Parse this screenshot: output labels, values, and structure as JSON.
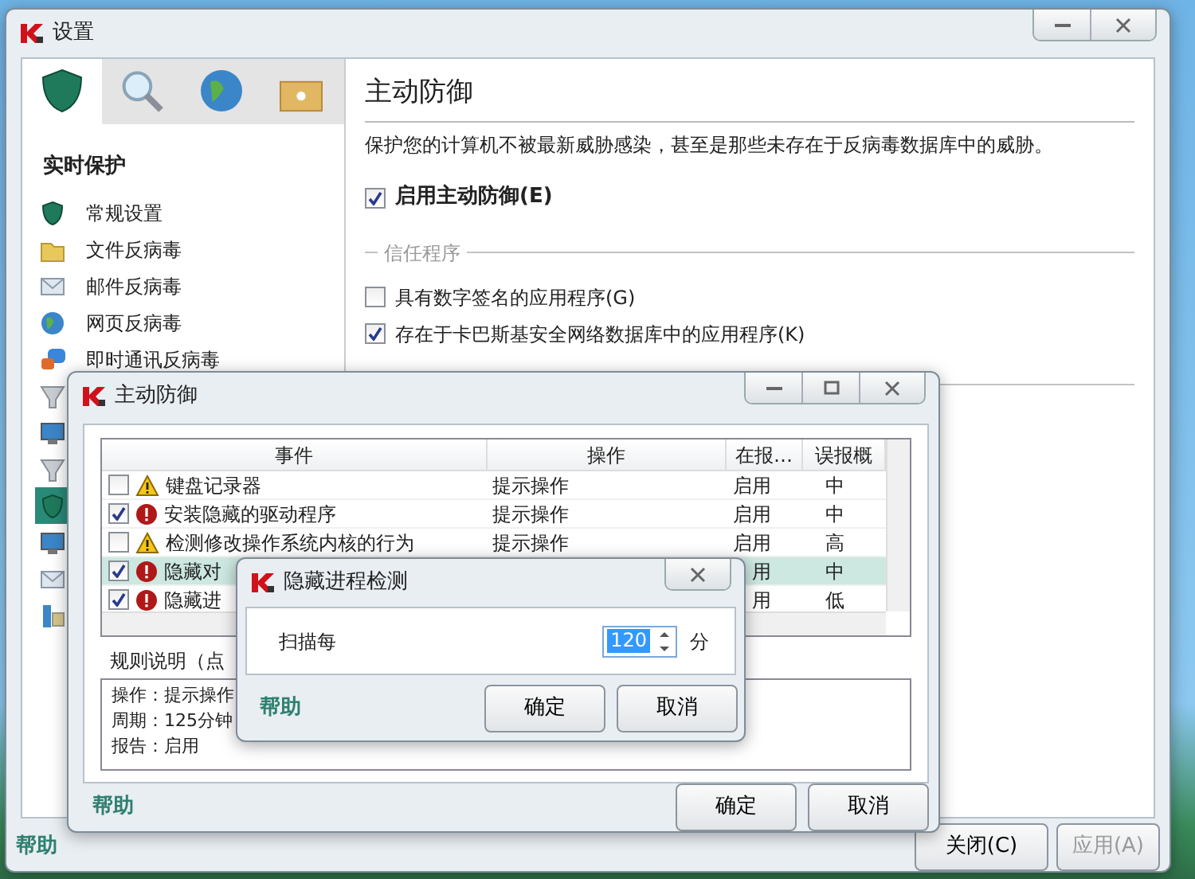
{
  "main_window": {
    "title": "设置",
    "tabs": [
      {
        "kind": "shield",
        "selected": true
      },
      {
        "kind": "search",
        "selected": false
      },
      {
        "kind": "globe",
        "selected": false
      },
      {
        "kind": "box",
        "selected": false
      }
    ],
    "sidebar": {
      "heading": "实时保护",
      "items": [
        {
          "kind": "shield",
          "label": "常规设置",
          "selected": false
        },
        {
          "kind": "folder",
          "label": "文件反病毒",
          "selected": false
        },
        {
          "kind": "mail",
          "label": "邮件反病毒",
          "selected": false
        },
        {
          "kind": "globe",
          "label": "网页反病毒",
          "selected": false
        },
        {
          "kind": "chat",
          "label": "即时通讯反病毒",
          "selected": false
        },
        {
          "kind": "funnel",
          "selected": false
        },
        {
          "kind": "monitor",
          "selected": false
        },
        {
          "kind": "funnel",
          "selected": false
        },
        {
          "kind": "shield",
          "selected": true
        },
        {
          "kind": "monitor",
          "selected": false
        },
        {
          "kind": "mail",
          "selected": false
        },
        {
          "kind": "network",
          "selected": false
        }
      ]
    },
    "content": {
      "title": "主动防御",
      "description": "保护您的计算机不被最新威胁感染，甚至是那些未存在于反病毒数据库中的威胁。",
      "enable": {
        "label": "启用主动防御(E)",
        "checked": true
      },
      "group_title": "信任程序",
      "options": [
        {
          "label": "具有数字签名的应用程序(G)",
          "checked": false
        },
        {
          "label": "存在于卡巴斯基安全网络数据库中的应用程序(K)",
          "checked": true
        }
      ]
    },
    "footer": {
      "help": "帮助",
      "buttons": [
        {
          "label": "关闭(C)",
          "disabled": false
        },
        {
          "label": "应用(A)",
          "disabled": true
        }
      ]
    }
  },
  "proactive_window": {
    "title": "主动防御",
    "table": {
      "columns": [
        "事件",
        "操作",
        "在报…",
        "误报概"
      ],
      "rows": [
        {
          "checked": false,
          "kind": "warning",
          "event": "键盘记录器",
          "action": "提示操作",
          "report": "启用",
          "level": "中",
          "selected": false
        },
        {
          "checked": true,
          "kind": "error",
          "event": "安装隐藏的驱动程序",
          "action": "提示操作",
          "report": "启用",
          "level": "中",
          "selected": false
        },
        {
          "checked": false,
          "kind": "warning",
          "event": "检测修改操作系统内核的行为",
          "action": "提示操作",
          "report": "启用",
          "level": "高",
          "selected": false
        },
        {
          "checked": true,
          "kind": "error",
          "event": "隐藏对",
          "report": "用",
          "level": "中",
          "selected": true
        },
        {
          "checked": true,
          "kind": "error",
          "event": "隐藏进",
          "report": "用",
          "level": "低",
          "selected": false
        }
      ]
    },
    "rule_caption": "规则说明（点",
    "rule_lines": [
      {
        "label": "操作：",
        "value": "提示操作"
      },
      {
        "label": "周期：",
        "value": "125分钟"
      },
      {
        "label": "报告：",
        "value": "启用"
      }
    ],
    "help": "帮助",
    "buttons": [
      "确定",
      "取消"
    ]
  },
  "dialog": {
    "title": "隐藏进程检测",
    "label": "扫描每",
    "value": "120",
    "unit": "分",
    "help": "帮助",
    "buttons": [
      "确定",
      "取消"
    ]
  }
}
